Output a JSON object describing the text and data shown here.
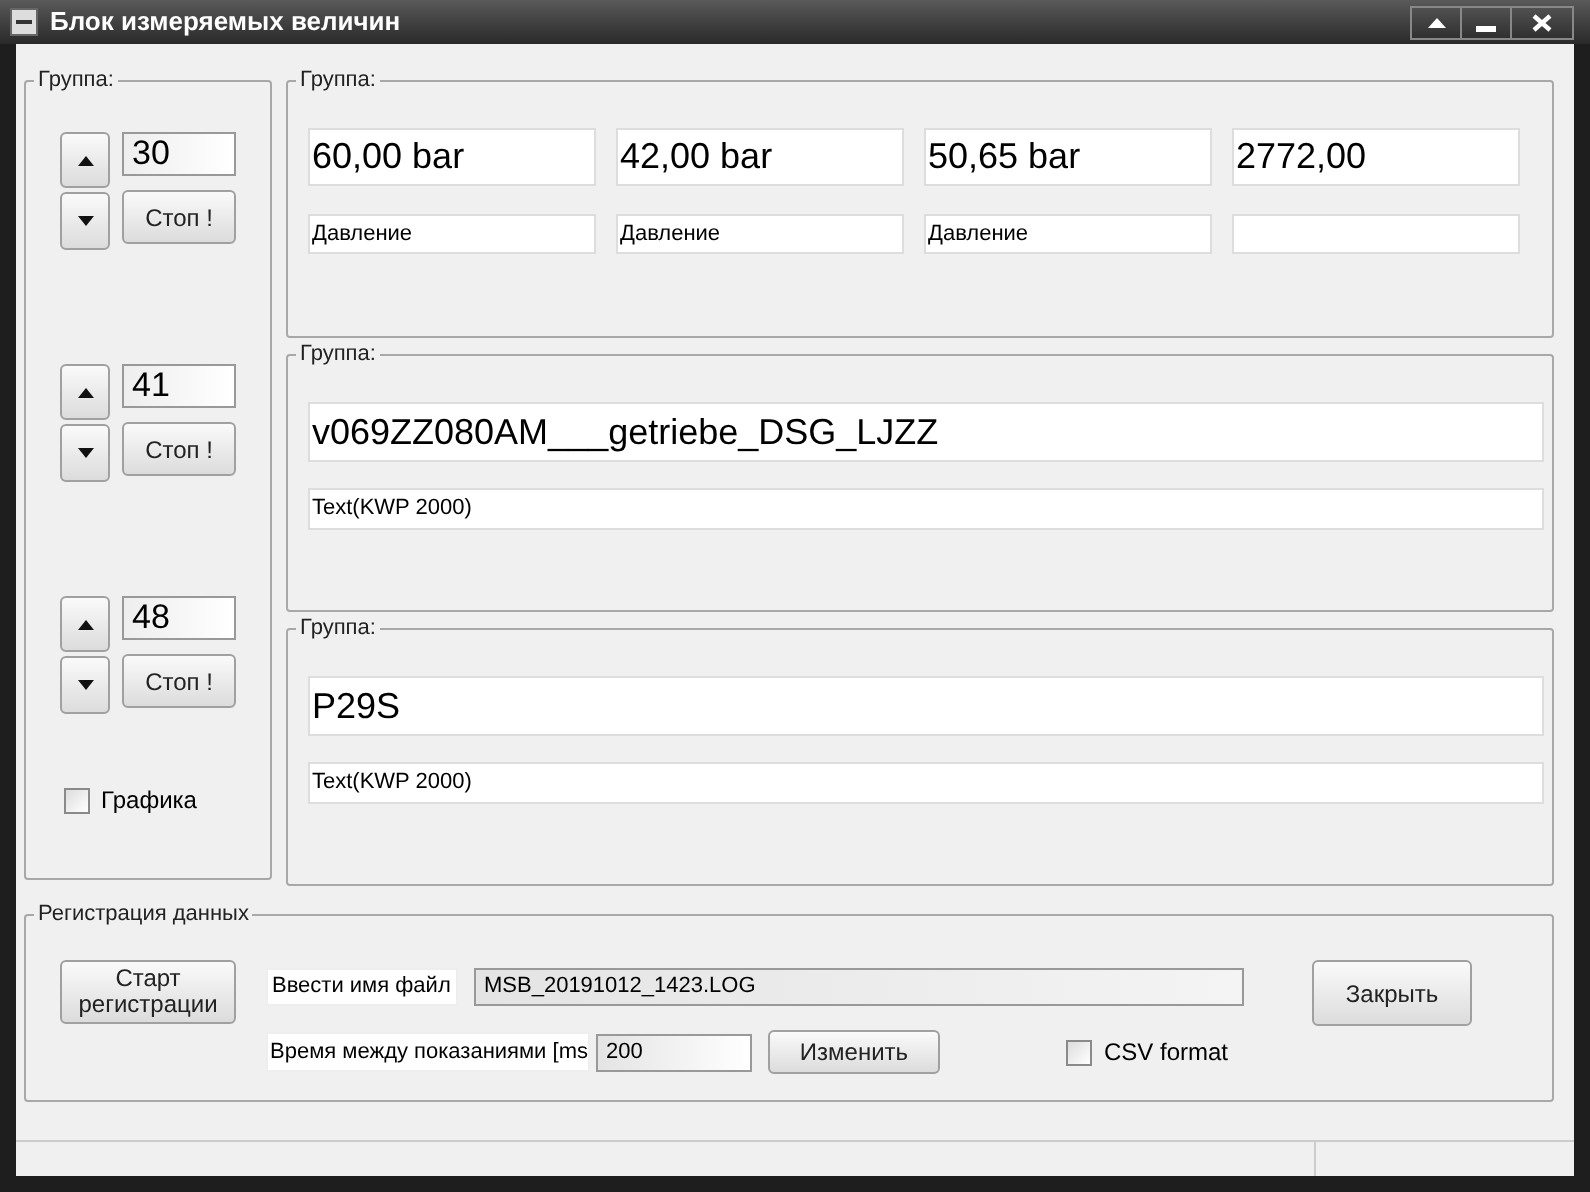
{
  "window": {
    "title": "Блок измеряемых величин"
  },
  "left_group": {
    "label": "Группа:",
    "counters": [
      {
        "value": "30",
        "stop": "Стоп !"
      },
      {
        "value": "41",
        "stop": "Стоп !"
      },
      {
        "value": "48",
        "stop": "Стоп !"
      }
    ],
    "graph": {
      "label": "Графика",
      "checked": false
    }
  },
  "groups": [
    {
      "label": "Группа:",
      "kind": "quad",
      "fields": [
        {
          "value": "60,00 bar",
          "caption": "Давление"
        },
        {
          "value": "42,00 bar",
          "caption": "Давление"
        },
        {
          "value": "50,65 bar",
          "caption": "Давление"
        },
        {
          "value": "2772,00"
        }
      ]
    },
    {
      "label": "Группа:",
      "kind": "single",
      "fields": [
        {
          "value": "v069ZZ080AM___getriebe_DSG_LJZZ",
          "caption": "Text(KWP 2000)"
        }
      ]
    },
    {
      "label": "Группа:",
      "kind": "single",
      "fields": [
        {
          "value": "P29S",
          "caption": "Text(KWP 2000)"
        }
      ]
    }
  ],
  "logging": {
    "label": "Регистрация данных",
    "start_button": "Старт\nрегистрации",
    "file_label": "Ввести имя файл",
    "file_name": "MSB_20191012_1423.LOG",
    "interval_label": "Время между показаниями [ms",
    "interval": "200",
    "change_button": "Изменить",
    "csv": {
      "label": "CSV format",
      "checked": false
    },
    "close_button": "Закрыть"
  }
}
